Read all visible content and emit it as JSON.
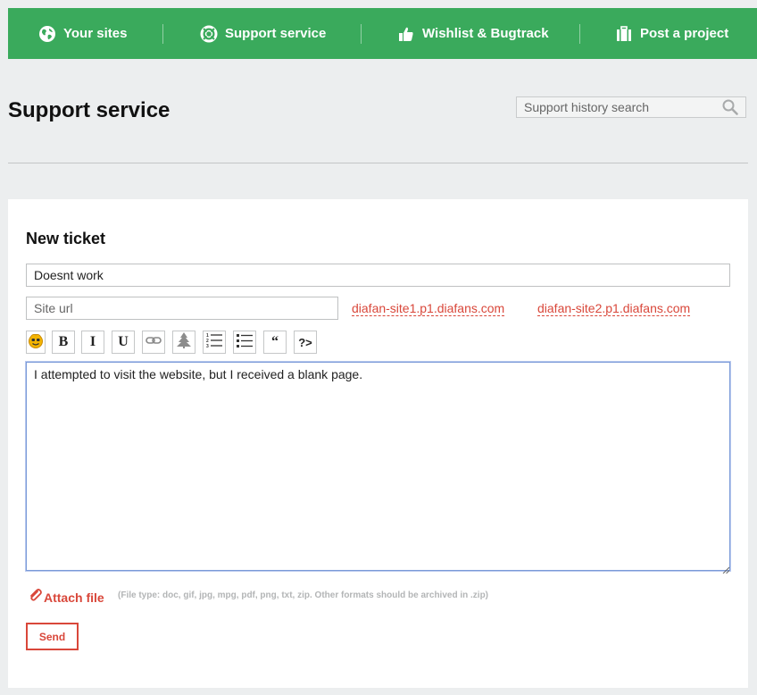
{
  "nav": {
    "items": [
      {
        "label": "Your sites",
        "icon": "globe-icon"
      },
      {
        "label": "Support service",
        "icon": "lifebuoy-icon"
      },
      {
        "label": "Wishlist & Bugtrack",
        "icon": "thumbs-up-icon"
      },
      {
        "label": "Post a project",
        "icon": "briefcase-icon"
      }
    ],
    "background": "#3aaa5c"
  },
  "header": {
    "title": "Support service",
    "search_placeholder": "Support history search"
  },
  "ticket": {
    "title": "New ticket",
    "subject_value": "Doesnt work",
    "url_placeholder": "Site url",
    "site_links": [
      "diafan-site1.p1.diafans.com",
      "diafan-site2.p1.diafans.com"
    ],
    "toolbar": {
      "bold": "B",
      "italic": "I",
      "underline": "U",
      "quote": "“",
      "code": "?>"
    },
    "message": "I attempted to visit the website, but I received a blank page.",
    "attach_label": "Attach file",
    "attach_note": "(File type: doc, gif, jpg, mpg, pdf, png, txt, zip. Other formats should be archived in .zip)",
    "send_label": "Send"
  },
  "colors": {
    "accent_red": "#d9473a",
    "green": "#3aaa5c"
  }
}
